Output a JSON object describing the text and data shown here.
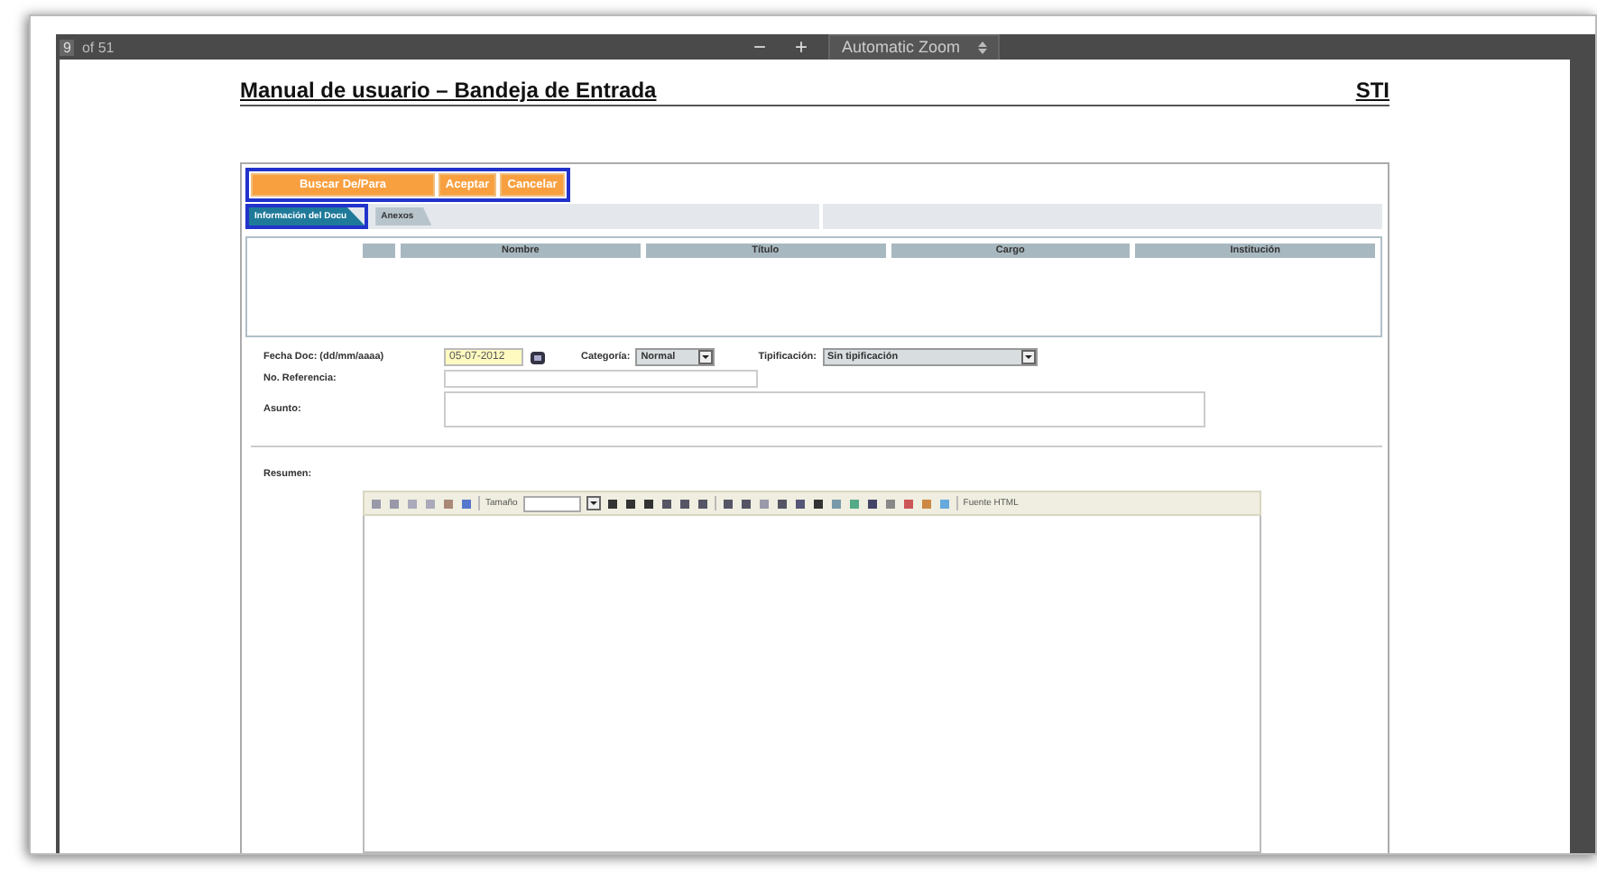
{
  "viewer_toolbar": {
    "page_number": "9",
    "page_count": "of 51",
    "zoom_out": "−",
    "zoom_in": "+",
    "zoom_select": "Automatic Zoom"
  },
  "page_header": {
    "title": "Manual de usuario – Bandeja de Entrada",
    "org": "STI"
  },
  "form": {
    "buttons": [
      {
        "label": "Buscar De/Para",
        "highlighted": true
      },
      {
        "label": "Aceptar",
        "highlighted": true
      },
      {
        "label": "Cancelar",
        "highlighted": true
      }
    ],
    "tabs": [
      {
        "label": "Información del Docu",
        "selected": true
      },
      {
        "label": "Anexos",
        "selected": false
      }
    ],
    "table": {
      "columns": [
        "Nombre",
        "Título",
        "Cargo",
        "Institución"
      ]
    },
    "fecha_label": "Fecha Doc: (dd/mm/aaaa)",
    "fecha_value": "05-07-2012",
    "categoria_label": "Categoría:",
    "categoria_value": "Normal",
    "tipificacion_label": "Tipificación:",
    "tipificacion_value": "Sin tipificación",
    "referencia_label": "No. Referencia:",
    "asunto_label": "Asunto:",
    "resumen_label": "Resumen:",
    "editor": {
      "size_label": "Tamaño",
      "source_label": "Fuente HTML"
    }
  }
}
